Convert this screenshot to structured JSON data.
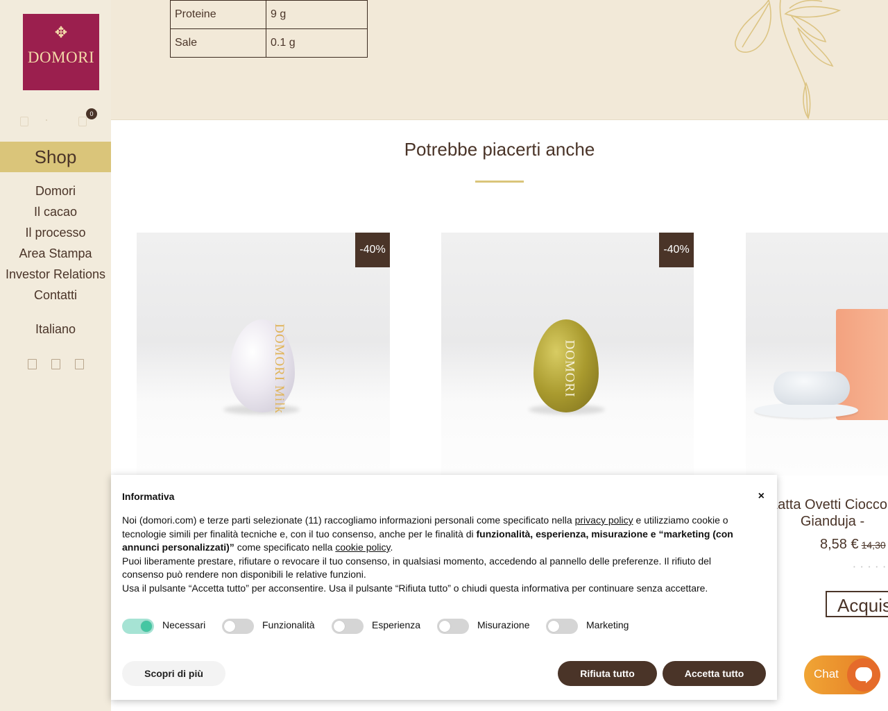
{
  "brand": {
    "name": "DOMORI"
  },
  "cart": {
    "count": "0"
  },
  "sidebar": {
    "shop_label": "Shop",
    "nav": [
      "Domori",
      "Il cacao",
      "Il processo",
      "Area Stampa",
      "Investor Relations",
      "Contatti"
    ],
    "language": "Italiano",
    "social_icons": [
      "facebook-icon",
      "instagram-icon",
      "linkedin-icon"
    ]
  },
  "nutrition": [
    {
      "label": "Proteine",
      "value": "9 g"
    },
    {
      "label": "Sale",
      "value": "0.1 g"
    }
  ],
  "related": {
    "title": "Potrebbe piacerti anche",
    "products": [
      {
        "badge": "-40%",
        "egg_brand": "DOMORI Milk",
        "egg_color": "#ece8f0"
      },
      {
        "badge": "-40%",
        "egg_brand": "DOMORI",
        "egg_color": "#a99a2e"
      },
      {
        "name_line1": "Latta Ovetti Cioccolato",
        "name_line2": "Gianduja -",
        "price": "8,58 €",
        "old_price": "14,30",
        "buy_label": "Acquista"
      }
    ]
  },
  "cookie": {
    "title": "Informativa",
    "close": "×",
    "p1_a": "Noi (domori.com) e terze parti selezionate (11) raccogliamo informazioni personali come specificato nella ",
    "p1_link": "privacy policy",
    "p1_b": " e utilizziamo cookie o tecnologie simili per finalità tecniche e, con il tuo consenso, anche per le finalità di ",
    "p1_bold": "funzionalità, esperienza, misurazione e “marketing (con annunci personalizzati)”",
    "p1_c": " come specificato nella ",
    "p1_link2": "cookie policy",
    "p1_d": ".",
    "p2": "Puoi liberamente prestare, rifiutare o revocare il tuo consenso, in qualsiasi momento, accedendo al pannello delle preferenze. Il rifiuto del consenso può rendere non disponibili le relative funzioni.",
    "p3": "Usa il pulsante “Accetta tutto” per acconsentire. Usa il pulsante “Rifiuta tutto” o chiudi questa informativa per continuare senza accettare.",
    "toggles": [
      {
        "label": "Necessari",
        "on": true
      },
      {
        "label": "Funzionalità",
        "on": false
      },
      {
        "label": "Esperienza",
        "on": false
      },
      {
        "label": "Misurazione",
        "on": false
      },
      {
        "label": "Marketing",
        "on": false
      }
    ],
    "learn_more": "Scopri di più",
    "reject_all": "Rifiuta tutto",
    "accept_all": "Accetta tutto"
  },
  "chat": {
    "label": "Chat"
  },
  "colors": {
    "brand": "#9b1f4e",
    "accent_gold": "#dac57a",
    "dark_brown": "#4a3428",
    "sidebar_bg": "#f2ebdc"
  }
}
